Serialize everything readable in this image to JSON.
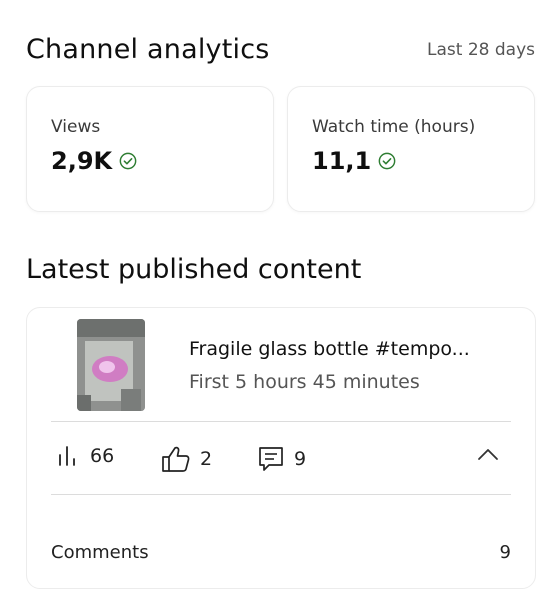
{
  "header": {
    "title": "Channel analytics",
    "period": "Last 28 days"
  },
  "cards": {
    "views": {
      "label": "Views",
      "value": "2,9K"
    },
    "watch_time": {
      "label": "Watch time (hours)",
      "value": "11,1"
    }
  },
  "latest": {
    "section_title": "Latest published content",
    "video": {
      "title": "Fragile glass bottle #tempo...",
      "subtitle": "First 5 hours 45 minutes",
      "views": "66",
      "likes": "2",
      "comments": "9"
    },
    "comments_row": {
      "label": "Comments",
      "value": "9"
    }
  },
  "colors": {
    "check": "#2e7d32",
    "text": "#0f0f0f",
    "muted": "#555555"
  },
  "icons": {
    "check": "check-circle-icon",
    "views": "bar-chart-icon",
    "likes": "thumbs-up-icon",
    "comments": "comment-icon",
    "collapse": "chevron-up-icon"
  }
}
